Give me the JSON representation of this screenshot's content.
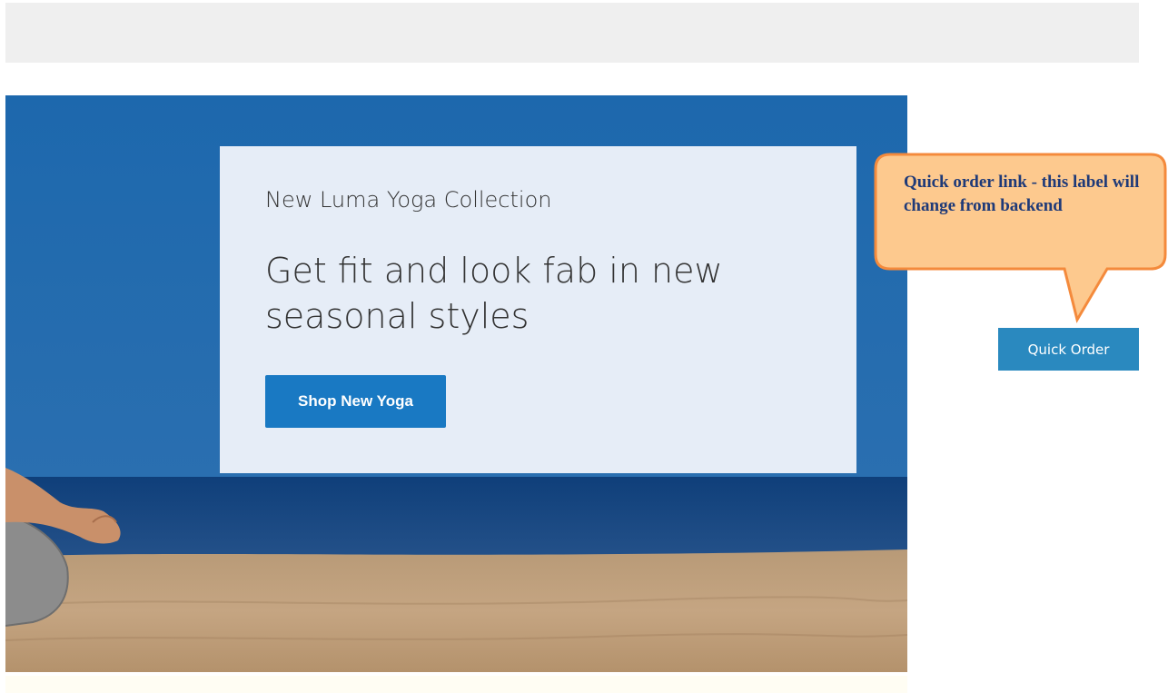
{
  "hero": {
    "subtitle": "New Luma Yoga Collection",
    "title": "Get fit and look fab in new seasonal styles",
    "cta_label": "Shop New Yoga"
  },
  "callout": {
    "text": "Quick order link - this label will change from backend",
    "fill_color": "#fdc98e",
    "border_color": "#f48a3c"
  },
  "quick_order": {
    "label": "Quick Order"
  },
  "colors": {
    "primary_button": "#1979c3",
    "quick_order_bg": "#2a89bf",
    "topbar_bg": "#efefef"
  }
}
